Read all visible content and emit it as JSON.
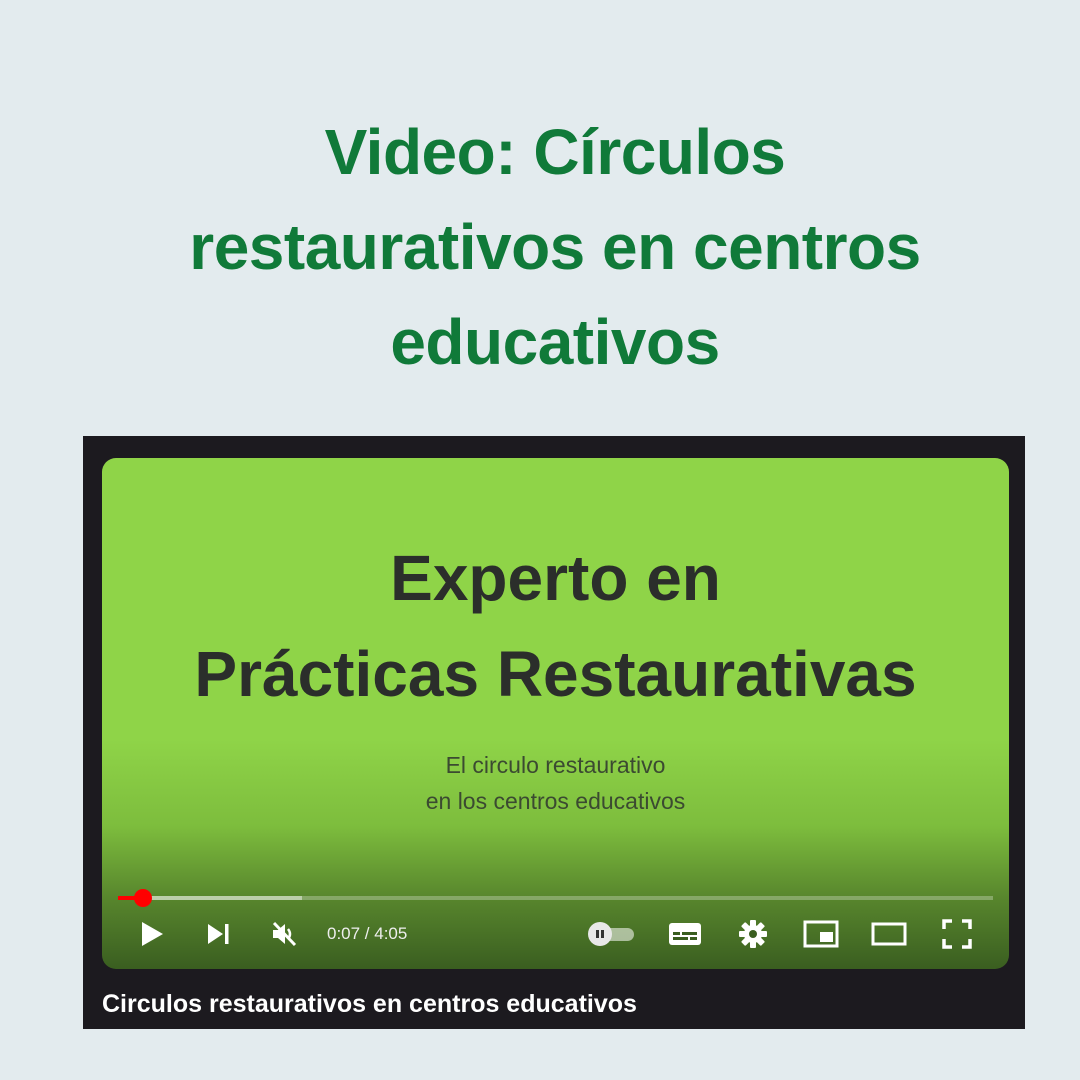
{
  "page": {
    "heading_lines": [
      "Video: Círculos",
      "restaurativos en centros",
      "educativos"
    ]
  },
  "video": {
    "slide_title_lines": [
      "Experto en",
      "Prácticas Restaurativas"
    ],
    "slide_subtitle_lines": [
      "El circulo restaurativo",
      "en los centros educativos"
    ],
    "caption": "Circulos restaurativos en centros educativos",
    "progress_fraction": 0.0286,
    "buffered_fraction": 0.21
  },
  "controls": {
    "time_display": "0:07 / 4:05",
    "icons": {
      "play": "play-icon",
      "next": "next-icon",
      "volume": "volume-muted-icon",
      "autoplay": "autoplay-toggle",
      "subtitles": "subtitles-icon",
      "settings": "settings-gear-icon",
      "miniplayer": "miniplayer-icon",
      "theater": "theater-mode-icon",
      "fullscreen": "fullscreen-icon"
    }
  },
  "colors": {
    "page_background": "#e3ebee",
    "heading": "#107a39",
    "slide_background": "#8fd448",
    "progress_played": "#ff0000"
  }
}
